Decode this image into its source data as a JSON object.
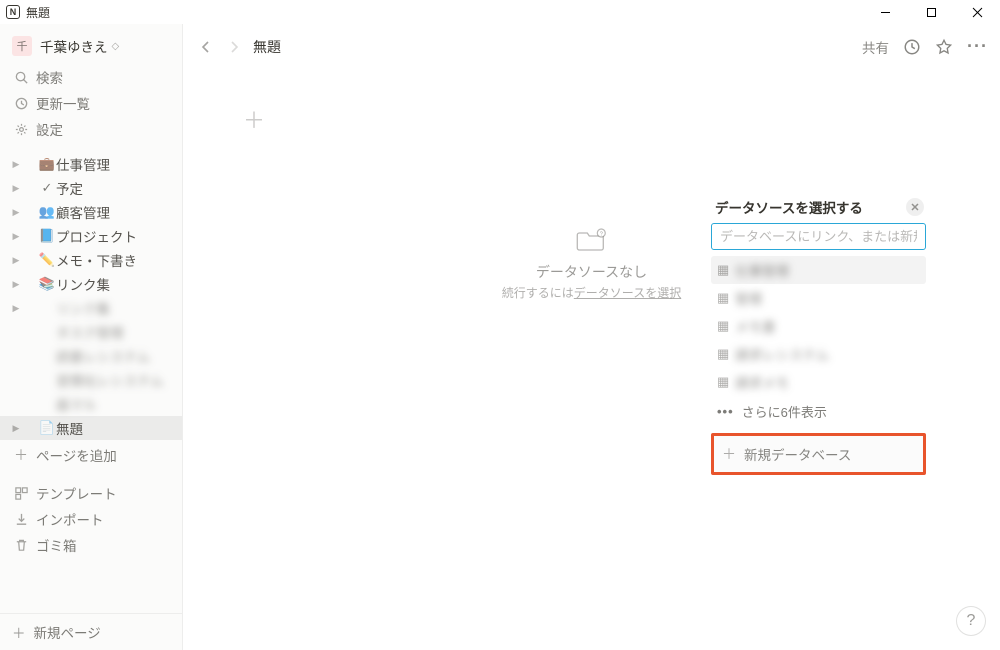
{
  "window": {
    "title": "無題"
  },
  "user": {
    "name": "千葉ゆきえ",
    "avatar_char": "千",
    "chev": "◇"
  },
  "sidebar_top": [
    {
      "icon": "search",
      "label": "検索"
    },
    {
      "icon": "clock",
      "label": "更新一覧"
    },
    {
      "icon": "gear",
      "label": "設定"
    }
  ],
  "sidebar_pages": [
    {
      "tri": "▶",
      "dot": "",
      "pico": "💼",
      "label": "仕事管理",
      "blurred": false
    },
    {
      "tri": "▶",
      "dot": "",
      "pico": "✓",
      "label": "予定",
      "blurred": false
    },
    {
      "tri": "▶",
      "dot": "",
      "pico": "👥",
      "label": "顧客管理",
      "blurred": false
    },
    {
      "tri": "▶",
      "dot": "",
      "pico": "📘",
      "label": "プロジェクト",
      "blurred": false
    },
    {
      "tri": "▶",
      "dot": "",
      "pico": "✏️",
      "label": "メモ・下書き",
      "blurred": false
    },
    {
      "tri": "▶",
      "dot": "",
      "pico": "📚",
      "label": "リンク集",
      "blurred": false
    },
    {
      "tri": "▶",
      "dot": "",
      "pico": "",
      "label": "リンク集",
      "blurred": true
    },
    {
      "tri": "",
      "dot": "",
      "pico": "",
      "label": "タスク管理",
      "blurred": true
    },
    {
      "tri": "",
      "dot": "",
      "pico": "",
      "label": "読書レシステム",
      "blurred": true
    },
    {
      "tri": "",
      "dot": "",
      "pico": "",
      "label": "習慣化レシステム",
      "blurred": true
    },
    {
      "tri": "",
      "dot": "",
      "pico": "",
      "label": "画マル",
      "blurred": true
    },
    {
      "tri": "▶",
      "dot": "",
      "pico": "📄",
      "label": "無題",
      "blurred": false,
      "selected": true
    }
  ],
  "sidebar_add_page": {
    "icon": "+",
    "label": "ページを追加"
  },
  "sidebar_util": [
    {
      "icon": "template",
      "label": "テンプレート"
    },
    {
      "icon": "import",
      "label": "インポート"
    },
    {
      "icon": "trash",
      "label": "ゴミ箱"
    }
  ],
  "sidebar_bottom": {
    "label": "新規ページ"
  },
  "breadcrumb": "無題",
  "topbar_right": {
    "share": "共有"
  },
  "empty": {
    "title": "データソースなし",
    "subtitle_prefix": "続行するには",
    "subtitle_link": "データソースを選択"
  },
  "popup": {
    "title": "データソースを選択する",
    "placeholder": "データベースにリンク、または新規作成...",
    "suggestions": [
      {
        "text": "仕事管理"
      },
      {
        "text": "管理"
      },
      {
        "text": "メモ書"
      },
      {
        "text": "請求レシステム"
      },
      {
        "text": "請求メモ"
      }
    ],
    "more": "さらに6件表示",
    "newdb": "新規データベース"
  },
  "help": "?"
}
